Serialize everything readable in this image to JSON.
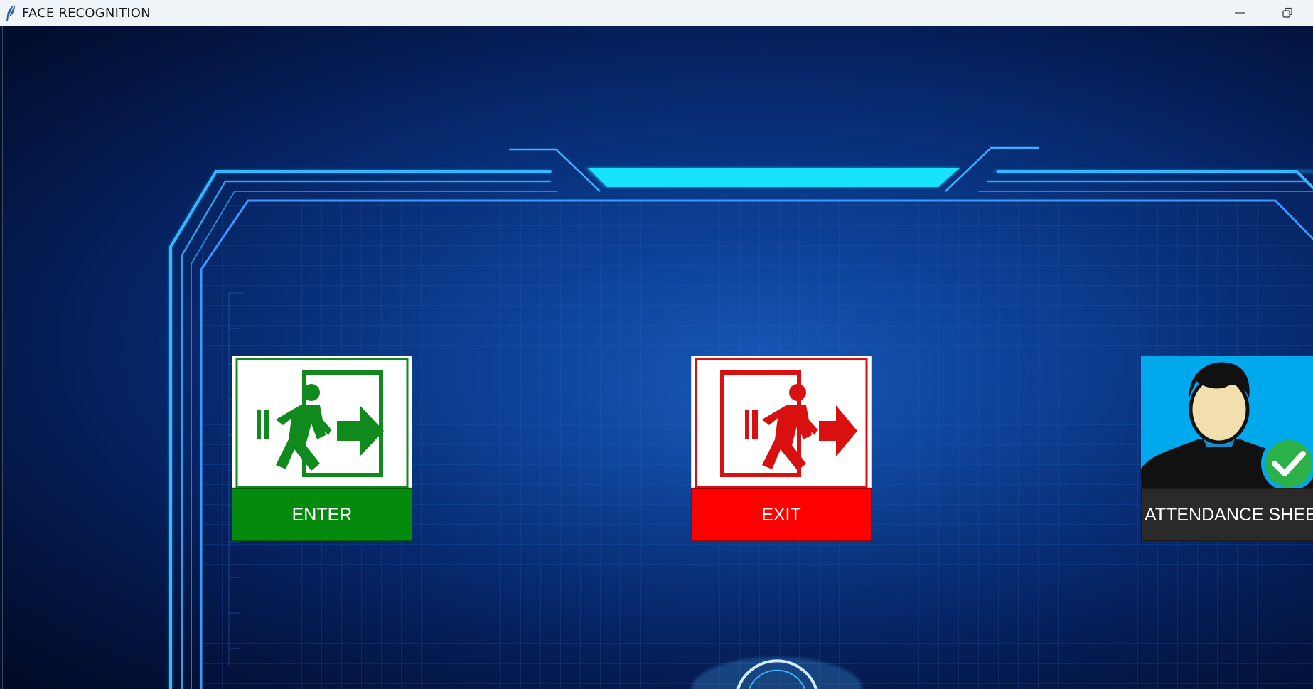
{
  "window": {
    "title": "FACE RECOGNITION",
    "controls": [
      "minimize",
      "restore"
    ]
  },
  "tiles": [
    {
      "id": "enter",
      "label": "ENTER",
      "label_bg": "#048a0c",
      "icon": "enter-door-icon",
      "icon_color": "#118a1d"
    },
    {
      "id": "exit",
      "label": "EXIT",
      "label_bg": "#fe0000",
      "icon": "exit-door-icon",
      "icon_color": "#d81010"
    },
    {
      "id": "attendance",
      "label": "ATTENDANCE SHEET",
      "label_bg": "#2a2a2a",
      "icon": "user-check-icon",
      "icon_color": "#00a8ec"
    }
  ],
  "theme": {
    "accent": "#29c6ff",
    "hud_cyan": "#16e6ff",
    "background_dark": "#02112a"
  }
}
